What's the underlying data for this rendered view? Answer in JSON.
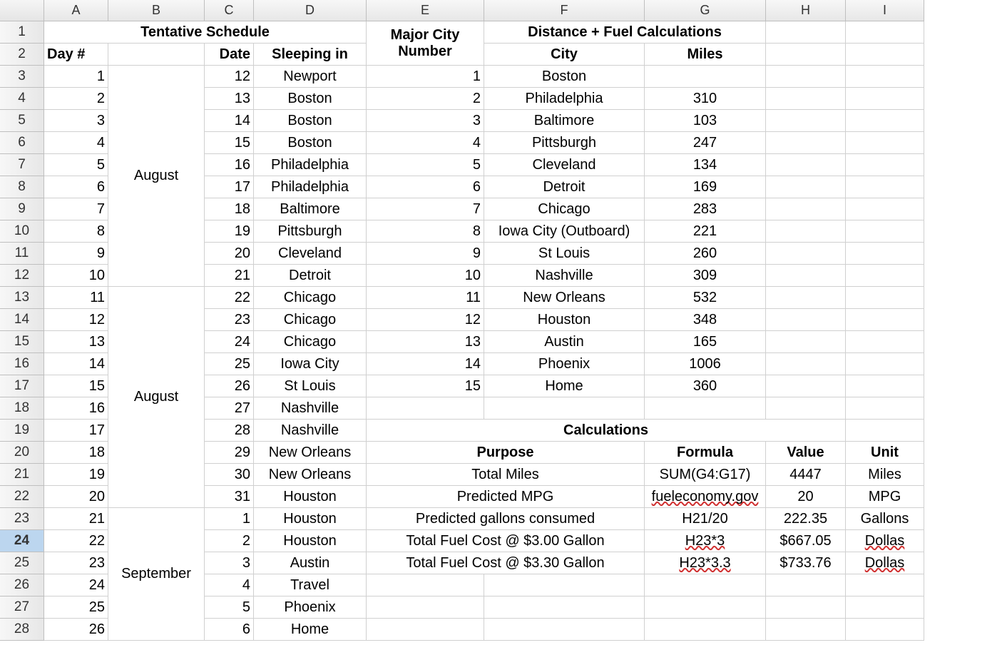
{
  "colHeaders": [
    "A",
    "B",
    "C",
    "D",
    "E",
    "F",
    "G",
    "H",
    "I"
  ],
  "rowHeaders": [
    "1",
    "2",
    "3",
    "4",
    "5",
    "6",
    "7",
    "8",
    "9",
    "10",
    "11",
    "12",
    "13",
    "14",
    "15",
    "16",
    "17",
    "18",
    "19",
    "20",
    "21",
    "22",
    "23",
    "24",
    "25",
    "26",
    "27",
    "28"
  ],
  "selectedRow": "24",
  "titles": {
    "tentative": "Tentative Schedule",
    "majorCity": "Major City Number",
    "distFuel": "Distance + Fuel Calculations",
    "day": "Day #",
    "date": "Date",
    "sleeping": "Sleeping in",
    "city": "City",
    "miles": "Miles",
    "calcs": "Calculations",
    "purpose": "Purpose",
    "formula": "Formula",
    "value": "Value",
    "unit": "Unit"
  },
  "schedule": [
    {
      "day": "1",
      "date": "12",
      "sleep": "Newport"
    },
    {
      "day": "2",
      "date": "13",
      "sleep": "Boston"
    },
    {
      "day": "3",
      "date": "14",
      "sleep": "Boston"
    },
    {
      "day": "4",
      "date": "15",
      "sleep": "Boston"
    },
    {
      "day": "5",
      "date": "16",
      "sleep": "Philadelphia"
    },
    {
      "day": "6",
      "date": "17",
      "sleep": "Philadelphia"
    },
    {
      "day": "7",
      "date": "18",
      "sleep": "Baltimore"
    },
    {
      "day": "8",
      "date": "19",
      "sleep": "Pittsburgh"
    },
    {
      "day": "9",
      "date": "20",
      "sleep": "Cleveland"
    },
    {
      "day": "10",
      "date": "21",
      "sleep": "Detroit"
    },
    {
      "day": "11",
      "date": "22",
      "sleep": "Chicago"
    },
    {
      "day": "12",
      "date": "23",
      "sleep": "Chicago"
    },
    {
      "day": "13",
      "date": "24",
      "sleep": "Chicago"
    },
    {
      "day": "14",
      "date": "25",
      "sleep": "Iowa City"
    },
    {
      "day": "15",
      "date": "26",
      "sleep": "St Louis"
    },
    {
      "day": "16",
      "date": "27",
      "sleep": "Nashville"
    },
    {
      "day": "17",
      "date": "28",
      "sleep": "Nashville"
    },
    {
      "day": "18",
      "date": "29",
      "sleep": "New Orleans"
    },
    {
      "day": "19",
      "date": "30",
      "sleep": "New Orleans"
    },
    {
      "day": "20",
      "date": "31",
      "sleep": "Houston"
    },
    {
      "day": "21",
      "date": "1",
      "sleep": "Houston"
    },
    {
      "day": "22",
      "date": "2",
      "sleep": "Houston"
    },
    {
      "day": "23",
      "date": "3",
      "sleep": "Austin"
    },
    {
      "day": "24",
      "date": "4",
      "sleep": "Travel"
    },
    {
      "day": "25",
      "date": "5",
      "sleep": "Phoenix"
    },
    {
      "day": "26",
      "date": "6",
      "sleep": "Home"
    }
  ],
  "months": {
    "aug1": "August",
    "aug2": "August",
    "sep": "September"
  },
  "cities": [
    {
      "n": "1",
      "city": "Boston",
      "miles": ""
    },
    {
      "n": "2",
      "city": "Philadelphia",
      "miles": "310"
    },
    {
      "n": "3",
      "city": "Baltimore",
      "miles": "103"
    },
    {
      "n": "4",
      "city": "Pittsburgh",
      "miles": "247"
    },
    {
      "n": "5",
      "city": "Cleveland",
      "miles": "134"
    },
    {
      "n": "6",
      "city": "Detroit",
      "miles": "169"
    },
    {
      "n": "7",
      "city": "Chicago",
      "miles": "283"
    },
    {
      "n": "8",
      "city": "Iowa City (Outboard)",
      "miles": "221"
    },
    {
      "n": "9",
      "city": "St Louis",
      "miles": "260"
    },
    {
      "n": "10",
      "city": "Nashville",
      "miles": "309"
    },
    {
      "n": "11",
      "city": "New Orleans",
      "miles": "532"
    },
    {
      "n": "12",
      "city": "Houston",
      "miles": "348"
    },
    {
      "n": "13",
      "city": "Austin",
      "miles": "165"
    },
    {
      "n": "14",
      "city": "Phoenix",
      "miles": "1006"
    },
    {
      "n": "15",
      "city": "Home",
      "miles": "360"
    }
  ],
  "calcRows": [
    {
      "purpose": "Total Miles",
      "formula": "SUM(G4:G17)",
      "value": "4447",
      "unit": "Miles",
      "spell": false
    },
    {
      "purpose": "Predicted MPG",
      "formula": "fueleconomy.gov",
      "value": "20",
      "unit": "MPG",
      "spell": true
    },
    {
      "purpose": "Predicted gallons consumed",
      "formula": "H21/20",
      "value": "222.35",
      "unit": "Gallons",
      "spell": false
    },
    {
      "purpose": "Total Fuel Cost @ $3.00 Gallon",
      "formula": "H23*3",
      "value": "$667.05",
      "unit": "Dollas",
      "spell": true,
      "unitspell": true
    },
    {
      "purpose": "Total Fuel Cost @ $3.30 Gallon",
      "formula": "H23*3.3",
      "value": "$733.76",
      "unit": "Dollas",
      "spell": true,
      "unitspell": true
    }
  ]
}
